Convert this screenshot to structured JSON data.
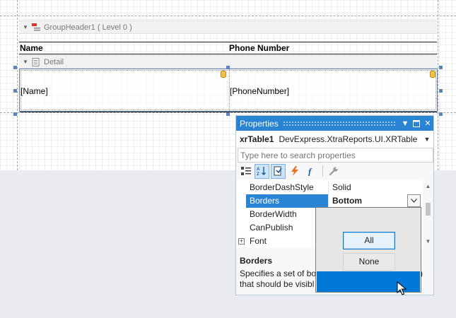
{
  "report": {
    "group_header_label": "GroupHeader1 ( Level 0 )",
    "detail_label": "Detail",
    "header_cells": [
      "Name",
      "Phone Number"
    ],
    "detail_cells": [
      "[Name]",
      "[PhoneNumber]"
    ]
  },
  "properties": {
    "title": "Properties",
    "object_name": "xrTable1",
    "object_type": "DevExpress.XtraReports.UI.XRTable",
    "search_placeholder": "Type here to search properties",
    "toolbar_icons": [
      "categorized-icon",
      "alphabetical-icon",
      "property-pages-icon",
      "events-icon",
      "expressions-icon",
      "wrench-icon"
    ],
    "rows": [
      {
        "name": "BorderDashStyle",
        "value": "Solid"
      },
      {
        "name": "Borders",
        "value": "Bottom"
      },
      {
        "name": "BorderWidth",
        "value": ""
      },
      {
        "name": "CanPublish",
        "value": ""
      },
      {
        "name": "Font",
        "value": ""
      }
    ],
    "description": {
      "title": "Borders",
      "line1": "Specifies a set of bor",
      "line1_tail": ")",
      "line2": "that should be visibl"
    }
  },
  "dropdown": {
    "options": [
      "All",
      "None"
    ]
  },
  "colors": {
    "accent": "#2a84d4",
    "selection": "#0078d7",
    "workspace": "#e9ebf0"
  }
}
